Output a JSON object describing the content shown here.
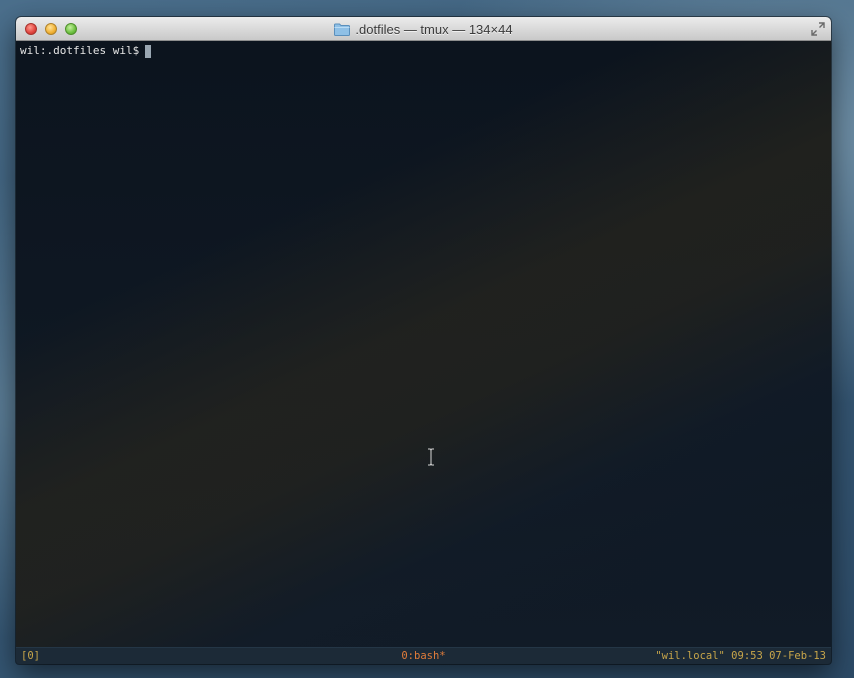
{
  "window": {
    "title": ".dotfiles — tmux — 134×44",
    "title_icon": "folder-icon",
    "buttons": [
      "close",
      "minimize",
      "zoom"
    ],
    "fullscreen_icon": "fullscreen-arrows-icon"
  },
  "terminal": {
    "prompt": "wil:.dotfiles wil$",
    "cursor": "block"
  },
  "statusbar": {
    "session": "[0]",
    "window_tab": "0:bash*",
    "right": "\"wil.local\" 09:53 07-Feb-13"
  },
  "colors": {
    "terminal_bg": "#0d1520",
    "prompt_text": "#e6e6e6",
    "status_bg": "#1c2a37",
    "status_text": "#c8a64a",
    "status_active": "#e07c3a"
  }
}
